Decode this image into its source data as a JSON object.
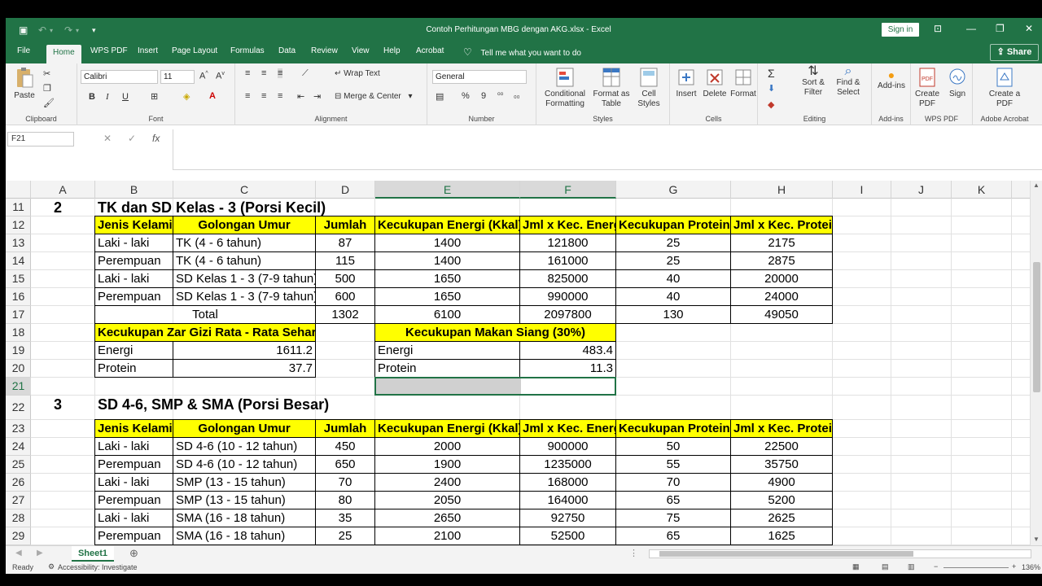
{
  "window": {
    "title": "Contoh Perhitungan MBG dengan AKG.xlsx  -  Excel",
    "signin": "Sign in"
  },
  "menu": {
    "tabs": [
      "File",
      "Home",
      "WPS PDF",
      "Insert",
      "Page Layout",
      "Formulas",
      "Data",
      "Review",
      "View",
      "Help",
      "Acrobat"
    ],
    "tellme": "Tell me what you want to do",
    "share": "Share"
  },
  "ribbon": {
    "clipboard": {
      "paste": "Paste",
      "label": "Clipboard"
    },
    "font": {
      "name": "Calibri",
      "size": "11",
      "label": "Font",
      "bold": "B",
      "italic": "I",
      "underline": "U"
    },
    "alignment": {
      "wrap": "Wrap Text",
      "merge": "Merge & Center",
      "label": "Alignment"
    },
    "number": {
      "format": "General",
      "label": "Number",
      "percent": "%",
      "comma": "9"
    },
    "styles": {
      "conditional": "Conditional Formatting",
      "format_table": "Format as Table",
      "cell_styles": "Cell Styles",
      "label": "Styles"
    },
    "cells": {
      "insert": "Insert",
      "delete": "Delete",
      "format": "Format",
      "label": "Cells"
    },
    "editing": {
      "sort": "Sort & Filter",
      "find": "Find & Select",
      "label": "Editing"
    },
    "addins": {
      "btn": "Add-ins",
      "label": "Add-ins"
    },
    "wps": {
      "create": "Create PDF",
      "sign": "Sign",
      "label": "WPS PDF"
    },
    "acrobat": {
      "create": "Create a PDF",
      "label": "Adobe Acrobat"
    }
  },
  "formula": {
    "namebox": "F21",
    "fx": "fx"
  },
  "columns": [
    "A",
    "B",
    "C",
    "D",
    "E",
    "F",
    "G",
    "H",
    "I",
    "J",
    "K"
  ],
  "rows": [
    "11",
    "12",
    "13",
    "14",
    "15",
    "16",
    "17",
    "18",
    "19",
    "20",
    "21",
    "22",
    "23",
    "24",
    "25",
    "26",
    "27",
    "28",
    "29"
  ],
  "section2": {
    "num": "2",
    "title": "TK dan SD Kelas  - 3 (Porsi Kecil)",
    "headers": [
      "Jenis Kelamin",
      "Golongan Umur",
      "Jumlah",
      "Kecukupan Energi (Kkal)",
      "Jml x Kec. Energi",
      "Kecukupan Protein",
      "Jml x Kec. Protein"
    ],
    "data": [
      [
        "Laki - laki",
        "TK (4 - 6 tahun)",
        "87",
        "1400",
        "121800",
        "25",
        "2175"
      ],
      [
        "Perempuan",
        "TK (4 - 6 tahun)",
        "115",
        "1400",
        "161000",
        "25",
        "2875"
      ],
      [
        "Laki - laki",
        "SD Kelas 1 - 3 (7-9 tahun)",
        "500",
        "1650",
        "825000",
        "40",
        "20000"
      ],
      [
        "Perempuan",
        "SD Kelas 1 - 3 (7-9 tahun)",
        "600",
        "1650",
        "990000",
        "40",
        "24000"
      ]
    ],
    "total": {
      "label": "Total",
      "jumlah": "1302",
      "energi": "6100",
      "jml_energi": "2097800",
      "protein": "130",
      "jml_protein": "49050"
    },
    "avg": {
      "title": "Kecukupan Zar Gizi Rata - Rata Sehari",
      "energi_label": "Energi",
      "energi": "1611.2",
      "protein_label": "Protein",
      "protein": "37.7"
    },
    "lunch": {
      "title": "Kecukupan Makan Siang (30%)",
      "energi_label": "Energi",
      "energi": "483.4",
      "protein_label": "Protein",
      "protein": "11.3"
    }
  },
  "section3": {
    "num": "3",
    "title": "SD 4-6, SMP & SMA (Porsi Besar)",
    "headers": [
      "Jenis Kelamin",
      "Golongan Umur",
      "Jumlah",
      "Kecukupan Energi (Kkal)",
      "Jml x Kec. Energi",
      "Kecukupan Protein",
      "Jml x Kec. Protein"
    ],
    "data": [
      [
        "Laki - laki",
        "SD 4-6 (10 - 12 tahun)",
        "450",
        "2000",
        "900000",
        "50",
        "22500"
      ],
      [
        "Perempuan",
        "SD 4-6 (10 - 12 tahun)",
        "650",
        "1900",
        "1235000",
        "55",
        "35750"
      ],
      [
        "Laki - laki",
        "SMP (13 - 15 tahun)",
        "70",
        "2400",
        "168000",
        "70",
        "4900"
      ],
      [
        "Perempuan",
        "SMP (13 - 15 tahun)",
        "80",
        "2050",
        "164000",
        "65",
        "5200"
      ],
      [
        "Laki - laki",
        "SMA (16 - 18 tahun)",
        "35",
        "2650",
        "92750",
        "75",
        "2625"
      ],
      [
        "Perempuan",
        "SMA (16 - 18 tahun)",
        "25",
        "2100",
        "52500",
        "65",
        "1625"
      ]
    ]
  },
  "sheets": [
    "Sheet1"
  ],
  "status": {
    "ready": "Ready",
    "accessibility": "Accessibility: Investigate",
    "zoom": "136%"
  },
  "colors": {
    "excel_green": "#217346",
    "highlight": "#ffff00"
  }
}
